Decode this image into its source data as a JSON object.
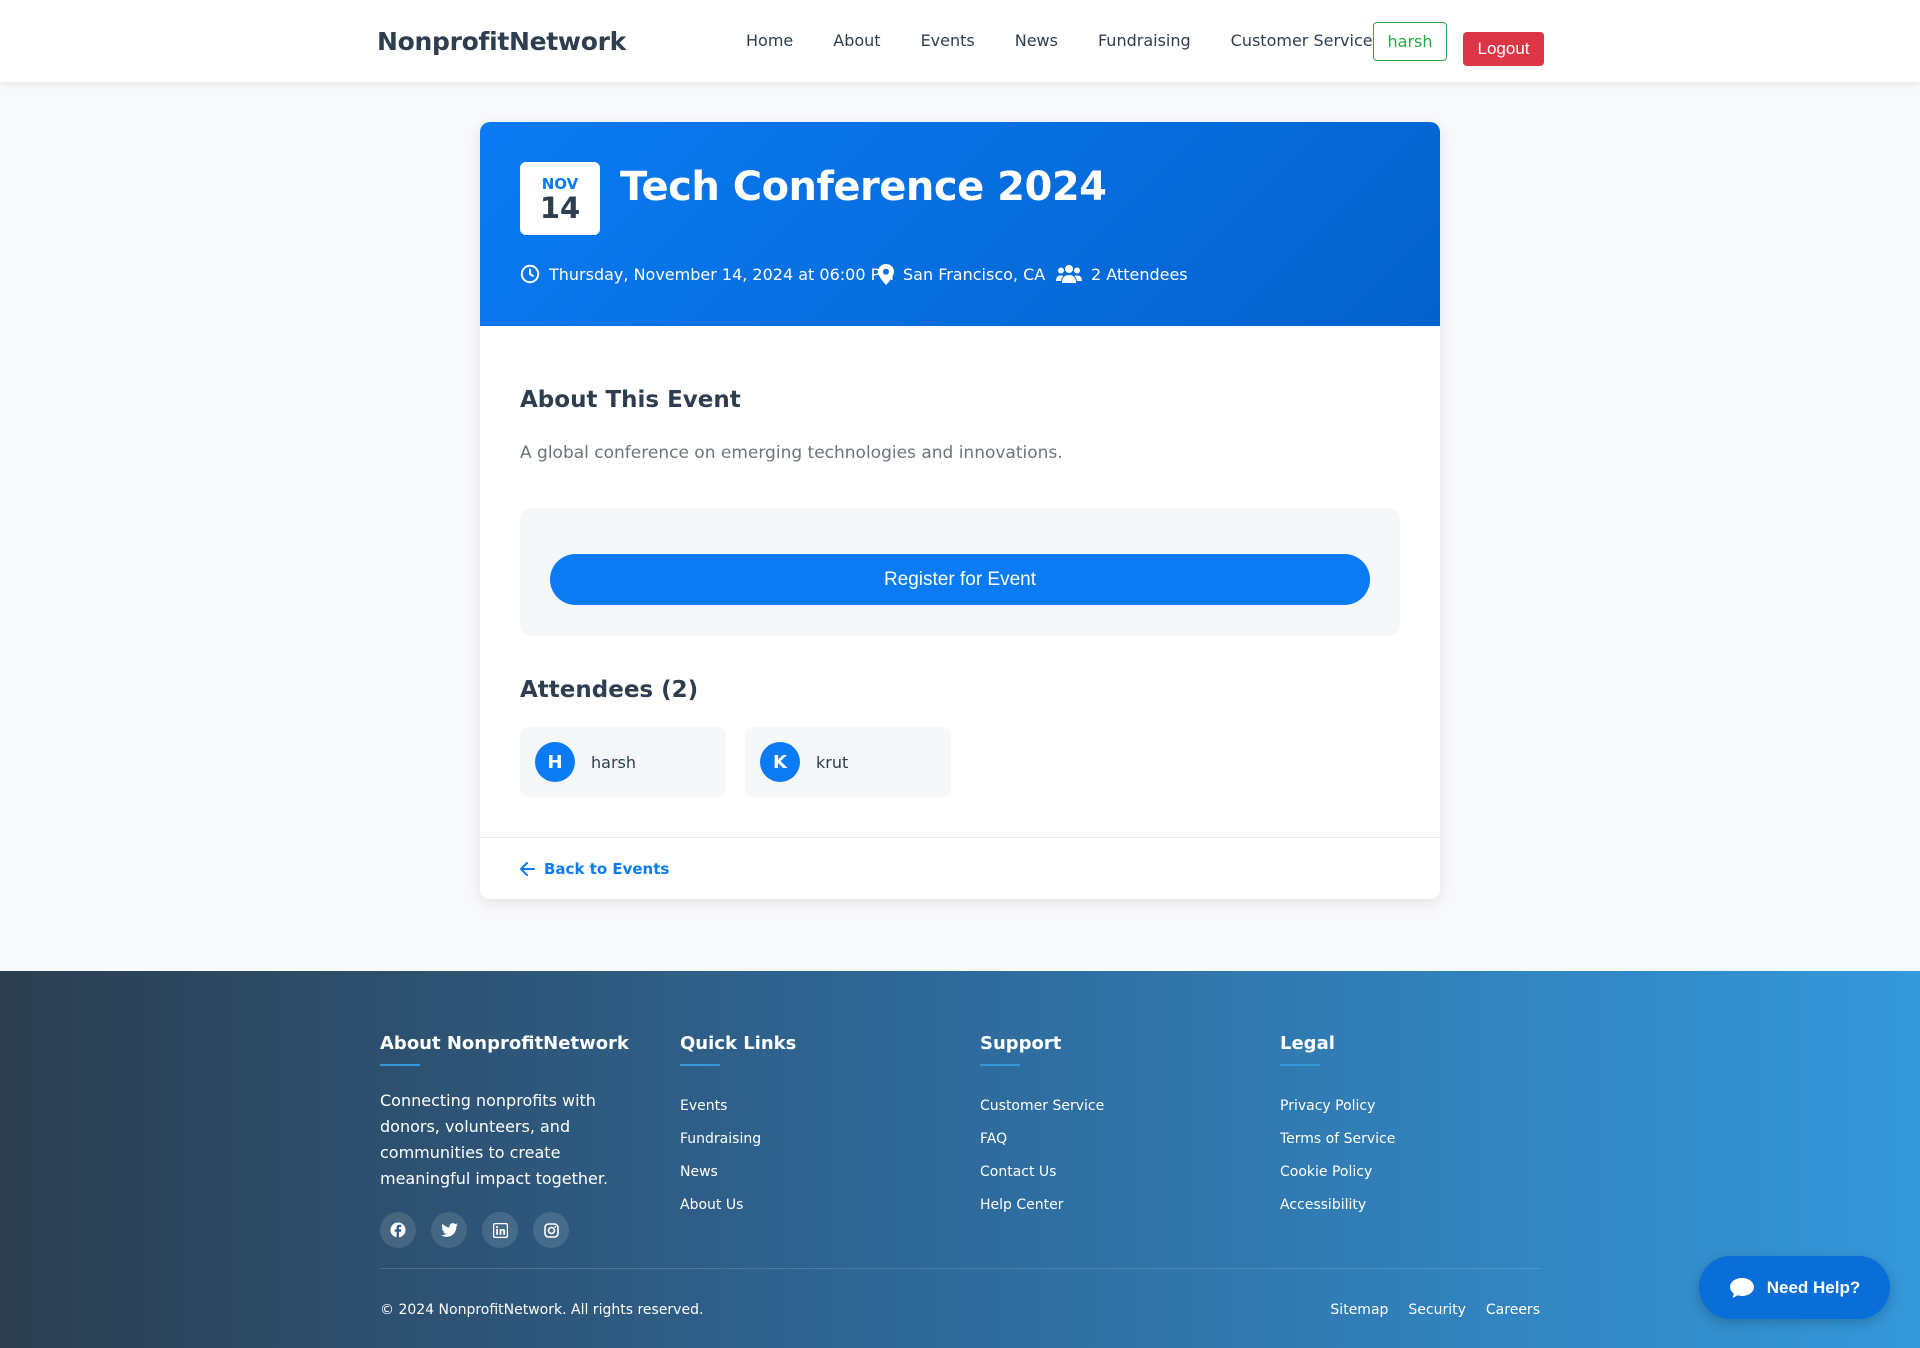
{
  "nav": {
    "brand": "NonprofitNetwork",
    "links": [
      "Home",
      "About",
      "Events",
      "News",
      "Fundraising",
      "Customer Service"
    ],
    "user": "harsh",
    "logout": "Logout"
  },
  "event": {
    "month": "NOV",
    "day": "14",
    "title": "Tech Conference 2024",
    "datetime": "Thursday, November 14, 2024 at 06:00 PM",
    "location": "San Francisco, CA",
    "attendee_count": "2 Attendees",
    "about_heading": "About This Event",
    "description": "A global conference on emerging technologies and innovations.",
    "register_label": "Register for Event",
    "attendees_heading": "Attendees (2)",
    "attendees": [
      {
        "initial": "H",
        "name": "harsh"
      },
      {
        "initial": "K",
        "name": "krut"
      }
    ],
    "back_label": "Back to Events"
  },
  "footer": {
    "about_heading": "About NonprofitNetwork",
    "about_text": "Connecting nonprofits with donors, volunteers, and communities to create meaningful impact together.",
    "socials": [
      "facebook-icon",
      "twitter-icon",
      "linkedin-icon",
      "instagram-icon"
    ],
    "quick_heading": "Quick Links",
    "quick_links": [
      "Events",
      "Fundraising",
      "News",
      "About Us"
    ],
    "support_heading": "Support",
    "support_links": [
      "Customer Service",
      "FAQ",
      "Contact Us",
      "Help Center"
    ],
    "legal_heading": "Legal",
    "legal_links": [
      "Privacy Policy",
      "Terms of Service",
      "Cookie Policy",
      "Accessibility"
    ],
    "copyright": "© 2024 NonprofitNetwork. All rights reserved.",
    "bottom_links": [
      "Sitemap",
      "Security",
      "Careers"
    ]
  },
  "help": {
    "label": "Need Help?"
  },
  "colors": {
    "primary": "#0a7bf3",
    "danger": "#dc3545",
    "success": "#28a745",
    "text": "#2c3e50"
  }
}
